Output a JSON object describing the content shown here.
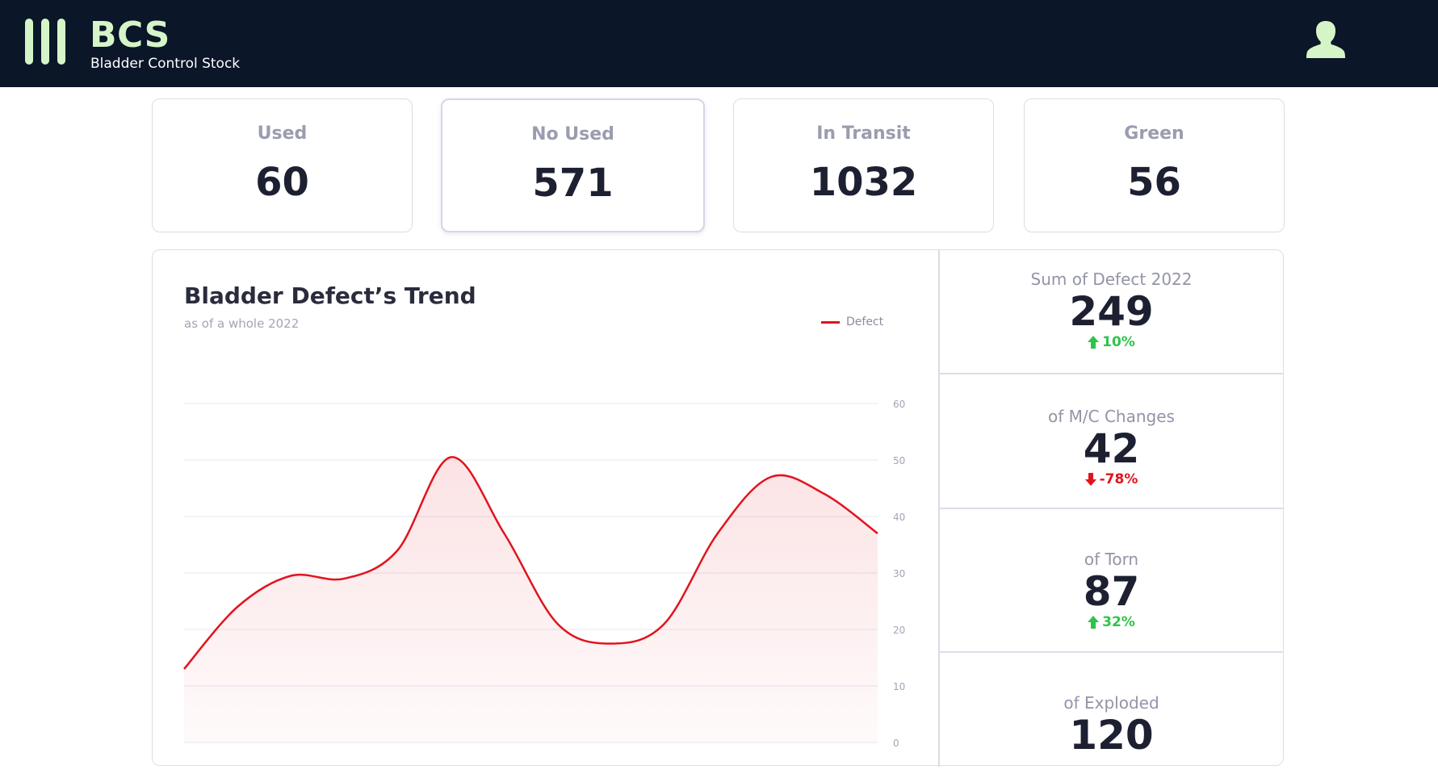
{
  "app": {
    "name": "BCS",
    "subtitle": "Bladder Control Stock"
  },
  "stats": [
    {
      "label": "Used",
      "value": "60"
    },
    {
      "label": "No Used",
      "value": "571"
    },
    {
      "label": "In Transit",
      "value": "1032"
    },
    {
      "label": "Green",
      "value": "56"
    }
  ],
  "trend": {
    "title": "Bladder Defect’s Trend",
    "subtitle": "as of a whole 2022",
    "legend_label": "Defect"
  },
  "kpis": [
    {
      "label": "Sum of Defect 2022",
      "value": "249",
      "change": "10%",
      "direction": "up"
    },
    {
      "label": "of M/C Changes",
      "value": "42",
      "change": "-78%",
      "direction": "down"
    },
    {
      "label": "of Torn",
      "value": "87",
      "change": "32%",
      "direction": "up"
    },
    {
      "label": "of Exploded",
      "value": "120"
    }
  ],
  "colors": {
    "topbar": "#0b1628",
    "brand": "#d5f5c8",
    "line": "#e0141e",
    "up": "#2ec44a",
    "down": "#e0141e"
  },
  "chart_data": {
    "type": "area",
    "title": "Bladder Defect’s Trend",
    "subtitle": "as of a whole 2022",
    "series": [
      {
        "name": "Defect",
        "values": [
          13,
          24,
          29.5,
          29,
          34,
          50.5,
          37,
          21,
          17.5,
          21,
          37,
          47,
          44,
          37
        ]
      }
    ],
    "ylim": [
      0,
      60
    ],
    "yticks": [
      0,
      10,
      20,
      30,
      40,
      50,
      60
    ],
    "y_axis_position": "right",
    "grid": true,
    "legend": "top-right"
  }
}
